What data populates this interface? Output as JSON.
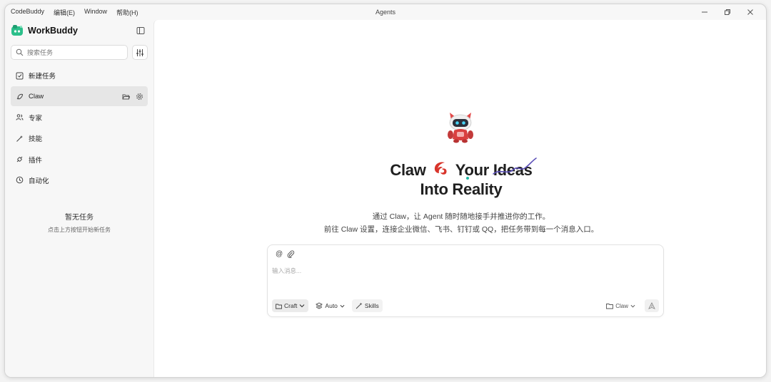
{
  "menu": [
    {
      "label": "CodeBuddy"
    },
    {
      "label": "编辑(E)"
    },
    {
      "label": "Window"
    },
    {
      "label": "帮助(H)"
    }
  ],
  "window_title": "Agents",
  "brand": {
    "name": "WorkBuddy",
    "accent": "#2bbf8a"
  },
  "search": {
    "placeholder": "搜索任务"
  },
  "nav": [
    {
      "label": "新建任务",
      "icon": "edit-square-icon"
    },
    {
      "label": "Claw",
      "icon": "claw-pen-icon",
      "active": true
    },
    {
      "label": "专家",
      "icon": "users-icon"
    },
    {
      "label": "技能",
      "icon": "magic-wand-icon"
    },
    {
      "label": "插件",
      "icon": "plug-icon"
    },
    {
      "label": "自动化",
      "icon": "clock-icon"
    }
  ],
  "empty": {
    "title": "暂无任务",
    "hint": "点击上方按钮开始新任务"
  },
  "hero": {
    "line1_a": "Claw",
    "line1_b": "Your",
    "line1_c": "Ideas",
    "line2": "Into Reality",
    "desc1": "通过 Claw，让 Agent 随时随地接手并推进你的工作。",
    "desc2": "前往 Claw 设置，连接企业微信、飞书、钉钉或 QQ，把任务带到每一个消息入口。",
    "logo_color": "#d8342b",
    "strike_color": "#5b4fb8"
  },
  "composer": {
    "at_symbol": "@",
    "placeholder": "输入消息...",
    "mode_label": "Craft",
    "model_label": "Auto",
    "skills_label": "Skills",
    "workspace_label": "Claw"
  }
}
